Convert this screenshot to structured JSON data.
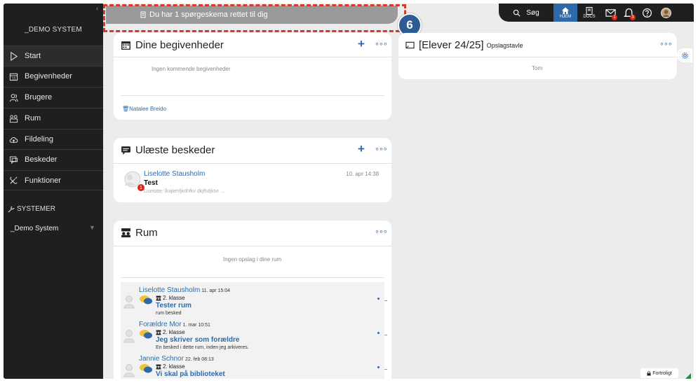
{
  "sidebar": {
    "system_title": "_DEMO SYSTEM",
    "items": [
      {
        "label": "Start",
        "icon": "play-icon"
      },
      {
        "label": "Begivenheder",
        "icon": "calendar-icon"
      },
      {
        "label": "Brugere",
        "icon": "users-icon"
      },
      {
        "label": "Rum",
        "icon": "room-icon"
      },
      {
        "label": "Fildeling",
        "icon": "cloud-icon"
      },
      {
        "label": "Beskeder",
        "icon": "messages-icon"
      },
      {
        "label": "Funktioner",
        "icon": "tools-icon"
      }
    ],
    "systems_heading": "SYSTEMER",
    "systems_item": "_Demo System"
  },
  "notice": {
    "text": "Du har 1 spørgeskema rettet til dig"
  },
  "step_marker": "6",
  "topnav": {
    "search_label": "Søg",
    "home_label": "HJEM",
    "docs_label": "DOCS",
    "mail_badge": "1",
    "bell_badge": "3"
  },
  "events": {
    "title": "Dine begivenheder",
    "empty": "Ingen kommende begivenheder",
    "footer_link": "Natalee Breido"
  },
  "messages": {
    "title": "Ulæste beskeder",
    "item": {
      "sender": "Liselotte Stausholm",
      "time": "10. apr 14:38",
      "subject": "Test",
      "preview": "Liselotte: lkajtehfjkdhfkv dkjfhdjktvr ...",
      "badge": "1"
    }
  },
  "rooms": {
    "title": "Rum",
    "empty": "Ingen opslag i dine rum",
    "items": [
      {
        "name": "Liselotte Stausholm",
        "date": "11. apr 15:04",
        "klass": "2. klasse",
        "title": "Tester rum",
        "desc": "rum besked"
      },
      {
        "name": "Forældre Mor",
        "date": "1. mar 10:51",
        "klass": "2. klasse",
        "title": "Jeg skriver som forældre",
        "desc": "En besked i dette rum, inden jeg arkiveres."
      },
      {
        "name": "Jannie Schnor",
        "date": "22. feb 08:13",
        "klass": "2. klasse",
        "title": "Vi skal på biblioteket",
        "desc": ""
      }
    ]
  },
  "board": {
    "title": "[Elever 24/25]",
    "subtitle": "Opslagstavle",
    "empty": "Tom"
  },
  "confidential": "Fortroligt",
  "colors": {
    "accent": "#2f6aa8",
    "highlight": "#d33b2c",
    "sidebar": "#1f1f1f"
  }
}
